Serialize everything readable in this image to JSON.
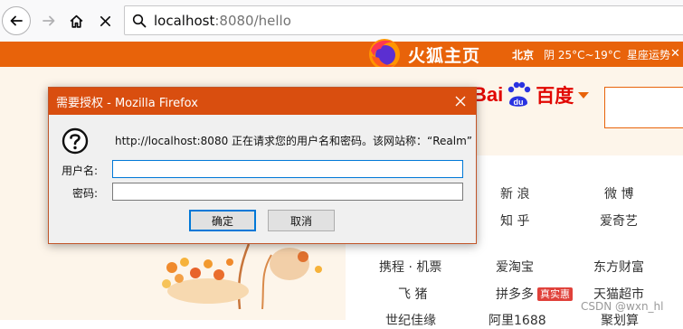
{
  "browser": {
    "url_host": "localhost",
    "url_rest": ":8080/hello"
  },
  "page": {
    "brand": "火狐主页",
    "weather": {
      "city": "北京",
      "temp": "阴 25°C~19°C",
      "astro": "星座运势",
      "close": "✕"
    },
    "search_brand": {
      "bai": "Bai",
      "du": "du",
      "cn": "百度"
    },
    "links": [
      {
        "text": "新 浪"
      },
      {
        "text": "微 博"
      },
      {
        "text": "知 乎"
      },
      {
        "text": "爱奇艺"
      },
      {
        "text": "携程 · 机票"
      },
      {
        "text": "爱淘宝"
      },
      {
        "text": "东方财富"
      },
      {
        "text": "飞 猪"
      },
      {
        "text": "拼多多"
      },
      {
        "text": "天猫超市"
      },
      {
        "text": "世纪佳缘"
      },
      {
        "text": "阿里1688"
      },
      {
        "text": "聚划算"
      }
    ],
    "badge": "真实惠",
    "watermark": "CSDN @wxn_hl"
  },
  "dialog": {
    "title": "需要授权 - Mozilla Firefox",
    "message": "http://localhost:8080 正在请求您的用户名和密码。该网站称：“Realm”",
    "username_label": "用户名:",
    "password_label": "密码:",
    "username_value": "",
    "password_value": "",
    "ok_label": "确定",
    "cancel_label": "取消"
  }
}
